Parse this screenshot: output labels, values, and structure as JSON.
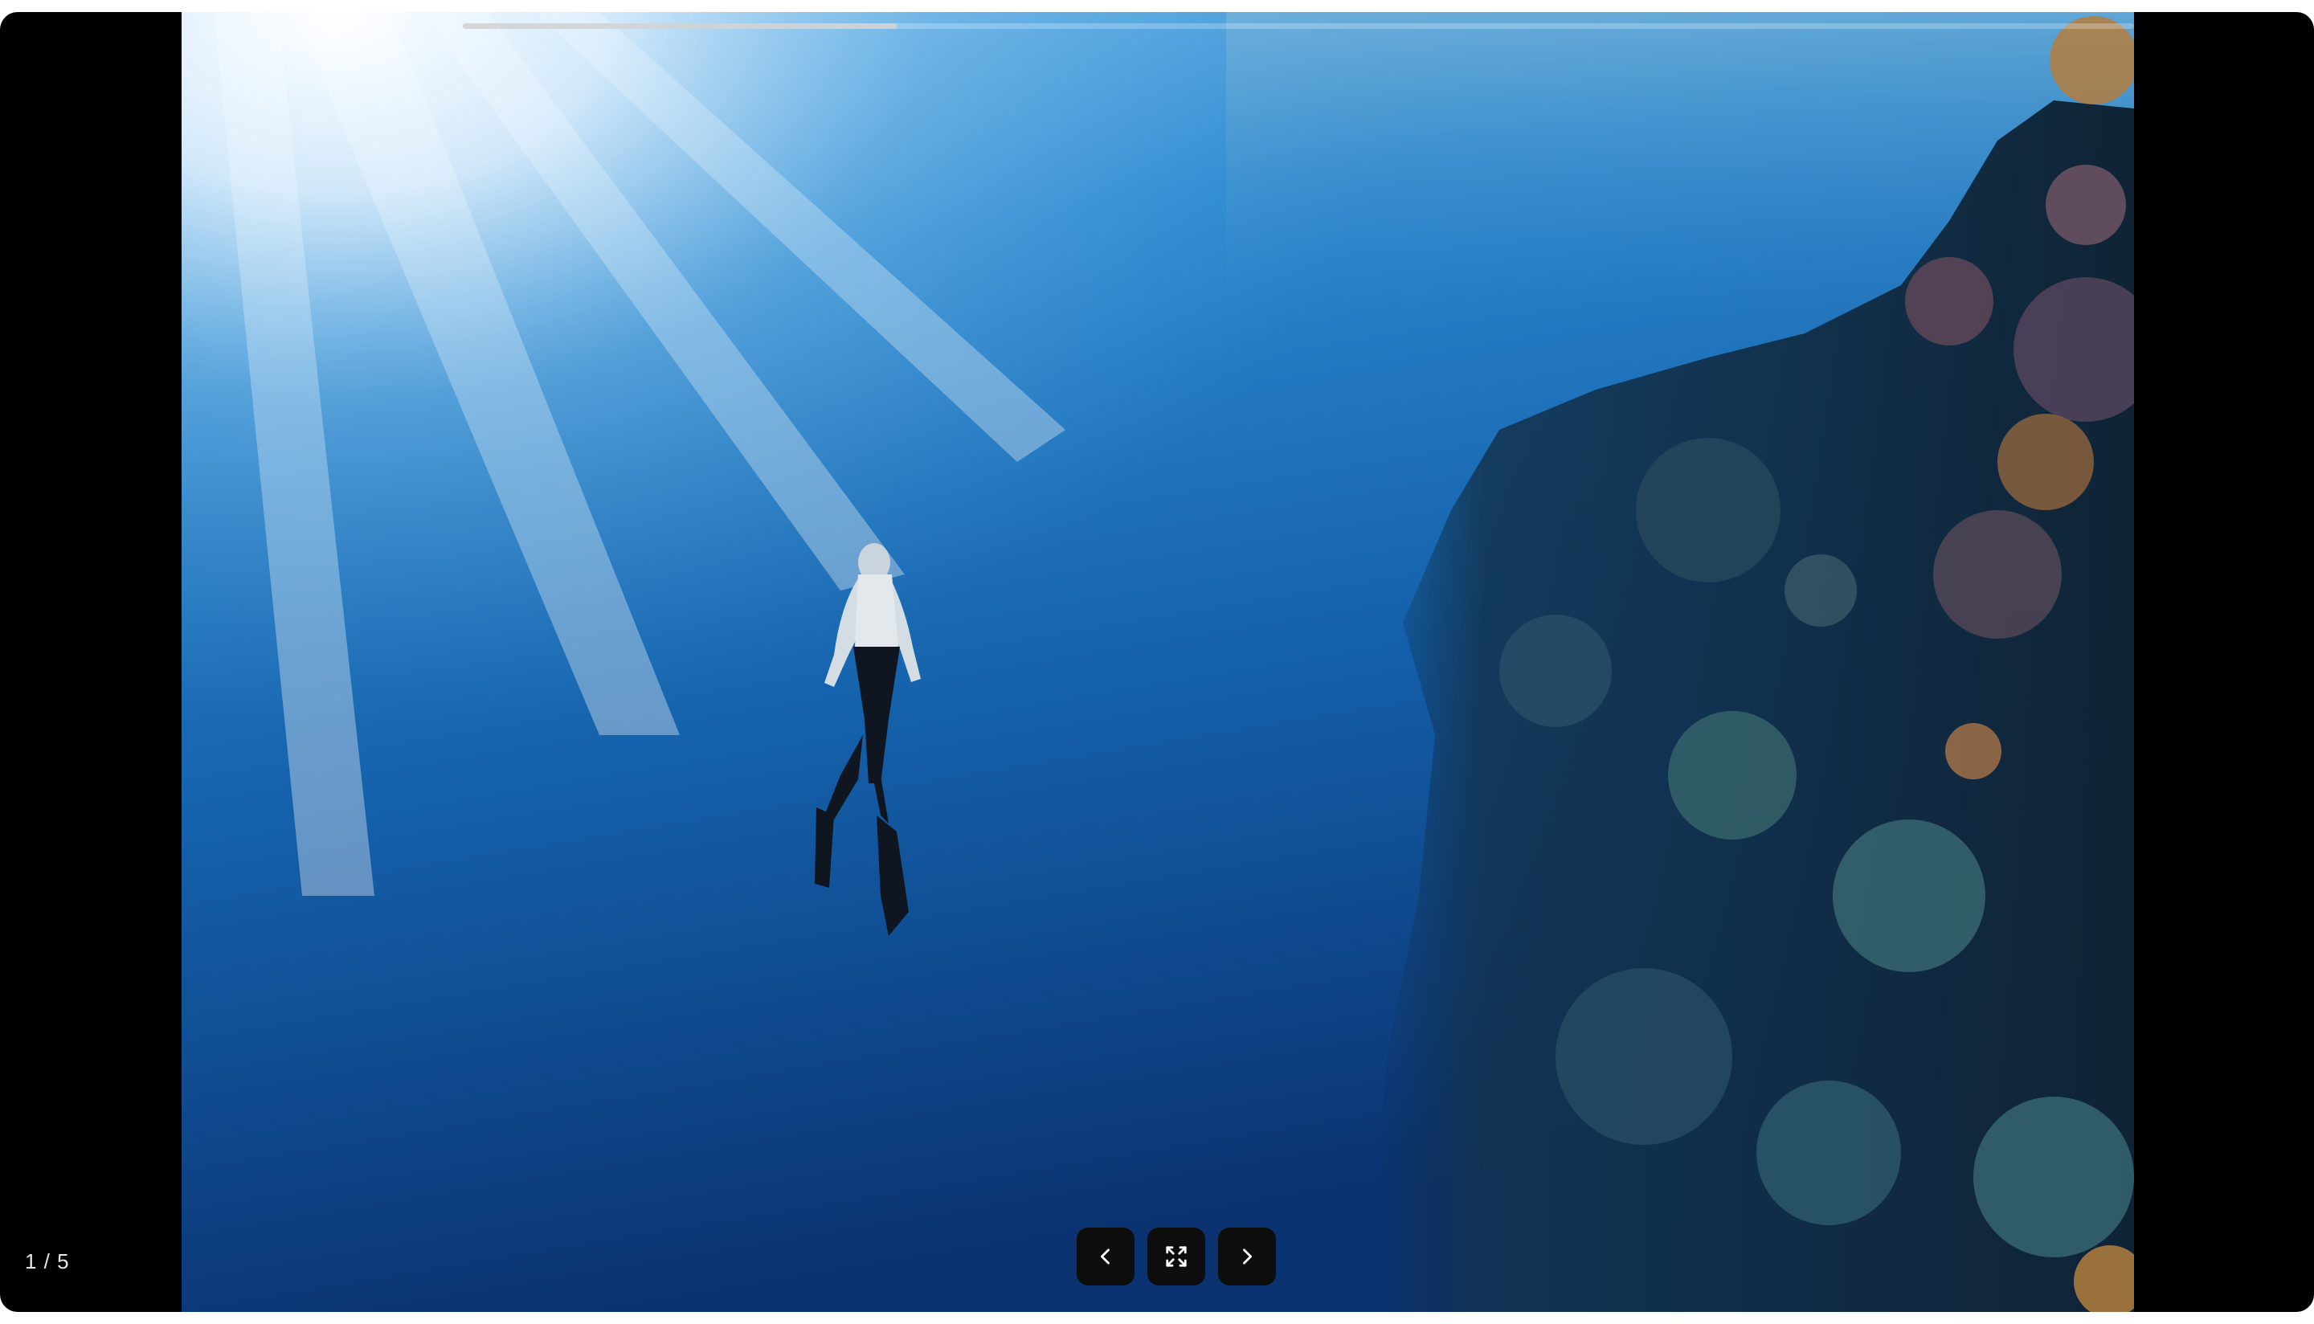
{
  "viewer": {
    "counter": "1 / 5",
    "current_index": 1,
    "total": 5,
    "progress_fraction": 0.26,
    "image_description_icon": "underwater-freediver-photo"
  },
  "controls": {
    "prev_icon": "chevron-left-icon",
    "fullscreen_icon": "expand-icon",
    "next_icon": "chevron-right-icon"
  },
  "colors": {
    "background": "#000000",
    "control_bg": "#0d0d0d",
    "water_light": "#2f8fd3",
    "water_deep": "#0a3670"
  }
}
